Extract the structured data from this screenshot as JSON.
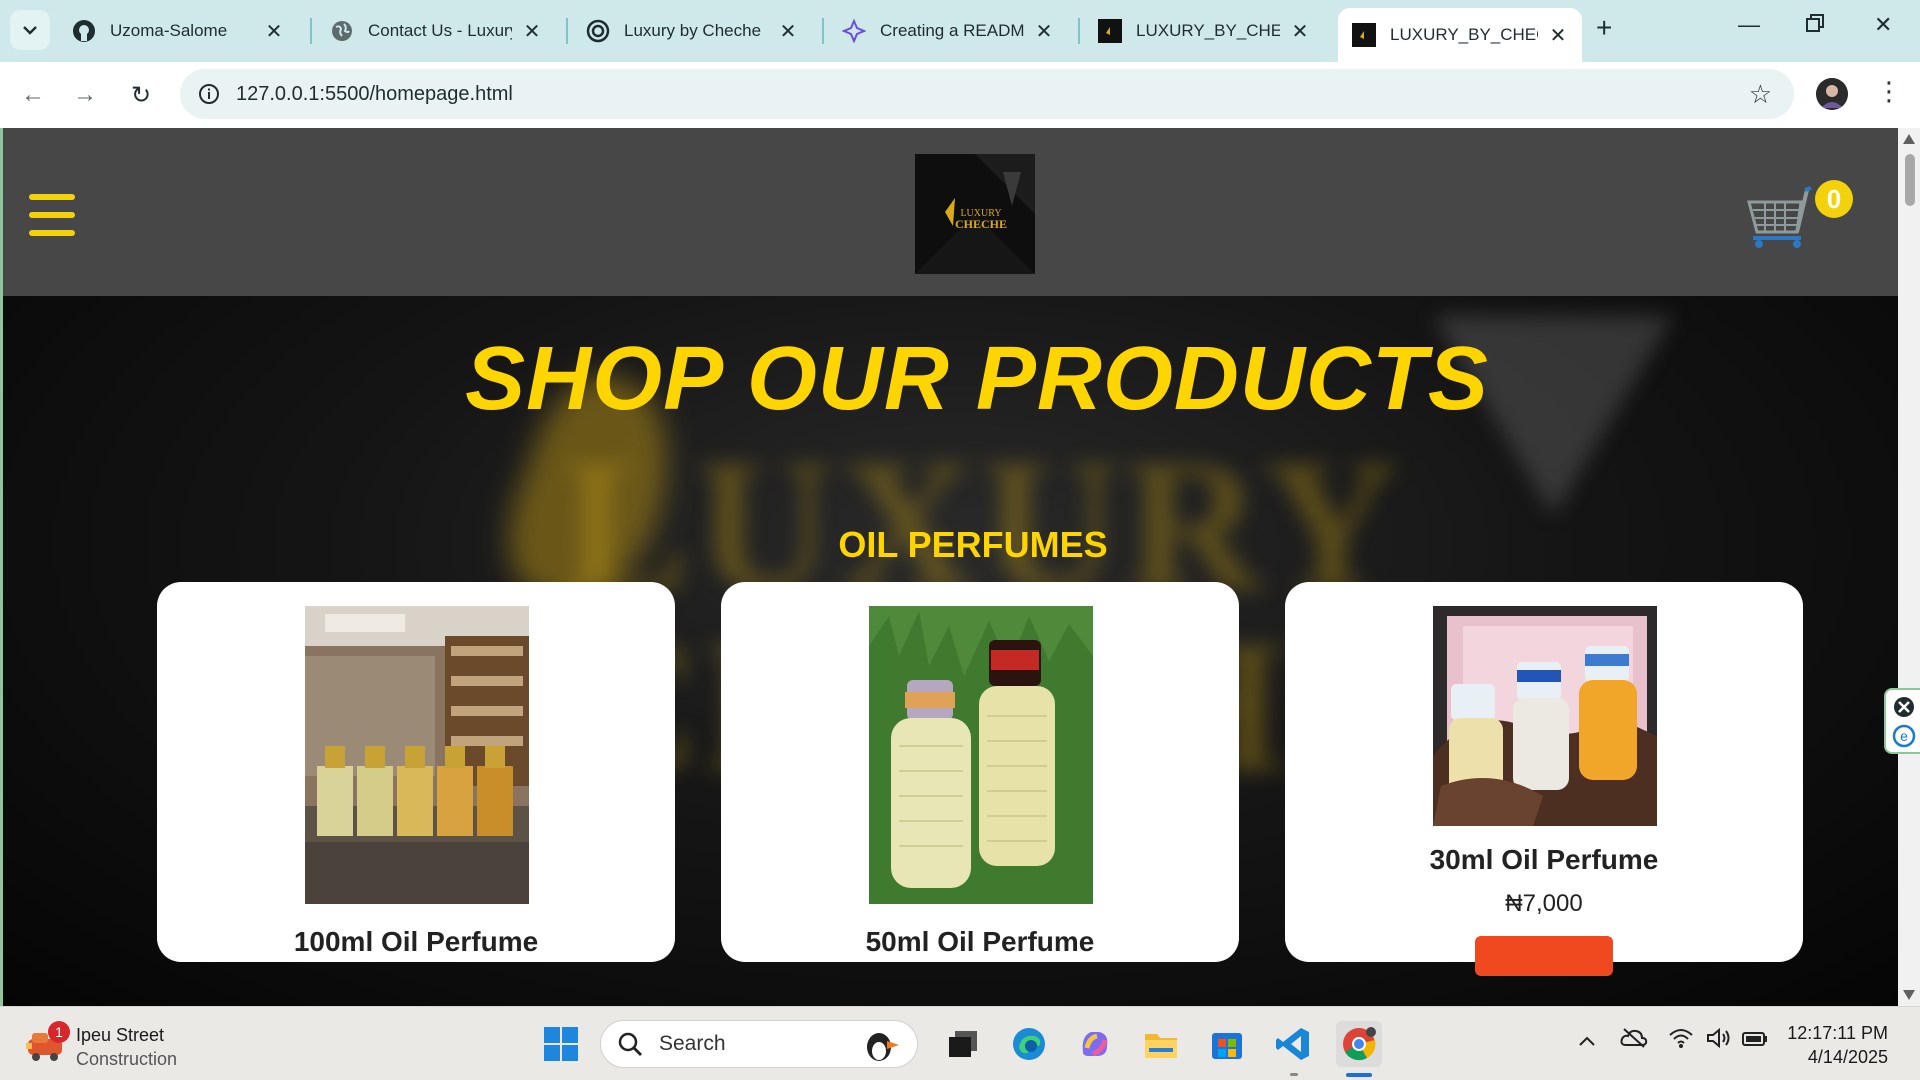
{
  "browser": {
    "tabs": [
      {
        "title": "Uzoma-Salome",
        "icon": "github-icon"
      },
      {
        "title": "Contact Us - Luxury",
        "icon": "globe-icon"
      },
      {
        "title": "Luxury by Cheche",
        "icon": "openai-icon"
      },
      {
        "title": "Creating a README",
        "icon": "ai-sparkle-icon"
      },
      {
        "title": "LUXURY_BY_CHECHE",
        "icon": "site-logo-icon"
      },
      {
        "title": "LUXURY_BY_CHECHE",
        "icon": "site-logo-icon",
        "active": true
      }
    ],
    "url": "127.0.0.1:5500/homepage.html"
  },
  "site": {
    "cart_count": "0",
    "hero_title": "SHOP OUR PRODUCTS",
    "hero_bg_text": "LUXURY CHECHE",
    "section_title": "OIL PERFUMES",
    "logo_text": "LUXURY CHECHE",
    "accent_color": "#ffd500",
    "products": [
      {
        "name": "100ml Oil Perfume",
        "price": ""
      },
      {
        "name": "50ml Oil Perfume",
        "price": ""
      },
      {
        "name": "30ml Oil Perfume",
        "price": "₦7,000"
      }
    ]
  },
  "taskbar": {
    "weather_badge": "1",
    "weather_line1": "Ipeu Street",
    "weather_line2": "Construction",
    "search_label": "Search",
    "time": "12:17:11 PM",
    "date": "4/14/2025"
  }
}
